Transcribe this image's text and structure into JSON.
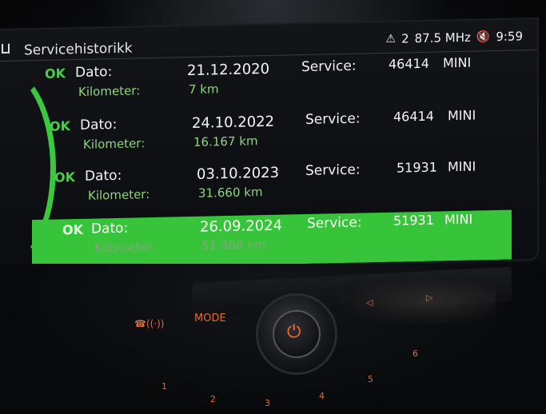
{
  "header": {
    "title": "Servicehistorikk",
    "warning_count": "2",
    "frequency": "87.5 MHz",
    "time": "9:59"
  },
  "records": [
    {
      "status": "OK",
      "date_label": "Dato:",
      "date": "21.12.2020",
      "service_label": "Service:",
      "service_code": "46414",
      "brand": "MINI",
      "km_label": "Kilometer:",
      "km": "7 km"
    },
    {
      "status": "OK",
      "date_label": "Dato:",
      "date": "24.10.2022",
      "service_label": "Service:",
      "service_code": "46414",
      "brand": "MINI",
      "km_label": "Kilometer:",
      "km": "16.167 km"
    },
    {
      "status": "OK",
      "date_label": "Dato:",
      "date": "03.10.2023",
      "service_label": "Service:",
      "service_code": "51931",
      "brand": "MINI",
      "km_label": "Kilometer:",
      "km": "31.660 km"
    },
    {
      "status": "OK",
      "date_label": "Dato:",
      "date": "26.09.2024",
      "service_label": "Service:",
      "service_code": "51931",
      "brand": "MINI",
      "km_label": "Kilometer:",
      "km": "51.468 km"
    }
  ],
  "selected_index": 3,
  "controls": {
    "mode_label": "MODE",
    "presets": [
      "1",
      "2",
      "3",
      "4",
      "5",
      "6"
    ]
  },
  "colors": {
    "accent": "#3cc83e",
    "ok": "#43d146",
    "km_text": "#8dd67a",
    "button": "#e06c36"
  }
}
